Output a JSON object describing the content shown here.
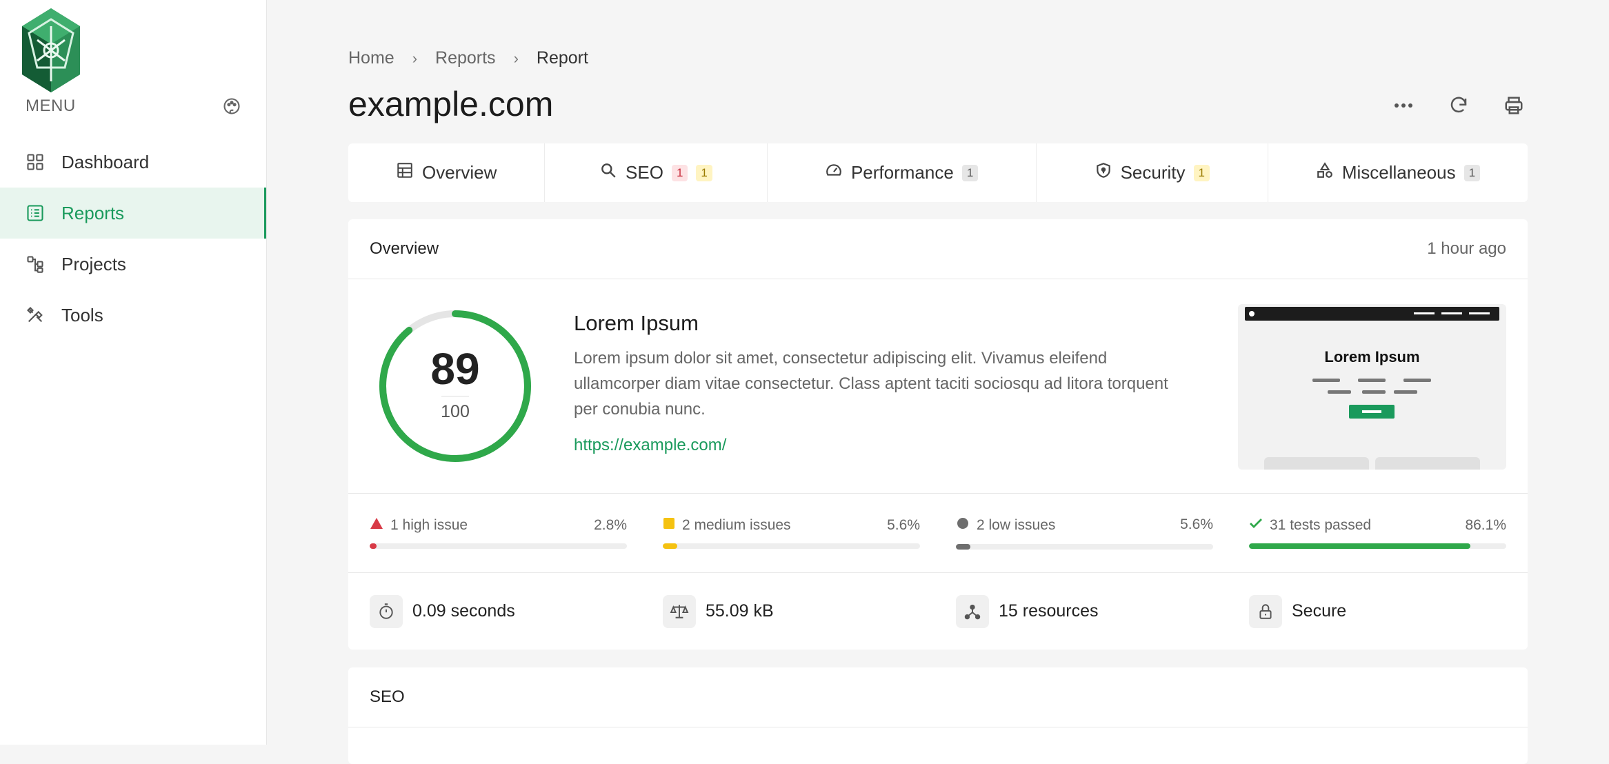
{
  "colors": {
    "accent": "#1a9a5c",
    "score_ring": "#2fa84a",
    "high": "#d83a47",
    "medium": "#f5c211",
    "low": "#6e6e6e",
    "passed": "#2fa84a"
  },
  "sidebar": {
    "menu_label": "MENU",
    "menu_icon": "palette-icon",
    "items": [
      {
        "label": "Dashboard",
        "icon": "grid-icon",
        "active": false
      },
      {
        "label": "Reports",
        "icon": "list-icon",
        "active": true
      },
      {
        "label": "Projects",
        "icon": "flow-icon",
        "active": false
      },
      {
        "label": "Tools",
        "icon": "tools-icon",
        "active": false
      }
    ]
  },
  "breadcrumb": [
    "Home",
    "Reports",
    "Report"
  ],
  "page": {
    "title": "example.com"
  },
  "toolbar": {
    "more_icon": "more-icon",
    "refresh_icon": "refresh-icon",
    "print_icon": "print-icon"
  },
  "tabs": [
    {
      "label": "Overview",
      "icon": "table-icon",
      "badges": []
    },
    {
      "label": "SEO",
      "icon": "search-icon",
      "badges": [
        {
          "text": "1",
          "kind": "red"
        },
        {
          "text": "1",
          "kind": "yellow"
        }
      ]
    },
    {
      "label": "Performance",
      "icon": "speedometer-icon",
      "badges": [
        {
          "text": "1",
          "kind": "gray"
        }
      ]
    },
    {
      "label": "Security",
      "icon": "shield-icon",
      "badges": [
        {
          "text": "1",
          "kind": "yellow"
        }
      ]
    },
    {
      "label": "Miscellaneous",
      "icon": "shapes-icon",
      "badges": [
        {
          "text": "1",
          "kind": "gray"
        }
      ]
    }
  ],
  "overview": {
    "title": "Overview",
    "timestamp": "1 hour ago",
    "score": "89",
    "score_max": "100",
    "score_fraction": 0.89,
    "heading": "Lorem Ipsum",
    "description": "Lorem ipsum dolor sit amet, consectetur adipiscing elit. Vivamus eleifend ullamcorper diam vitae consectetur. Class aptent taciti sociosqu ad litora torquent per conubia nunc.",
    "url": "https://example.com/",
    "thumbnail_title": "Lorem Ipsum",
    "issues": [
      {
        "label": "1 high issue",
        "percent": "2.8%",
        "fraction": 0.028,
        "kind": "high"
      },
      {
        "label": "2 medium issues",
        "percent": "5.6%",
        "fraction": 0.056,
        "kind": "medium"
      },
      {
        "label": "2 low issues",
        "percent": "5.6%",
        "fraction": 0.056,
        "kind": "low"
      },
      {
        "label": "31 tests passed",
        "percent": "86.1%",
        "fraction": 0.861,
        "kind": "passed"
      }
    ],
    "stats": [
      {
        "label": "0.09 seconds",
        "icon": "stopwatch-icon"
      },
      {
        "label": "55.09 kB",
        "icon": "scale-icon"
      },
      {
        "label": "15 resources",
        "icon": "resources-icon"
      },
      {
        "label": "Secure",
        "icon": "lock-icon"
      }
    ]
  },
  "seo_section": {
    "title": "SEO"
  }
}
